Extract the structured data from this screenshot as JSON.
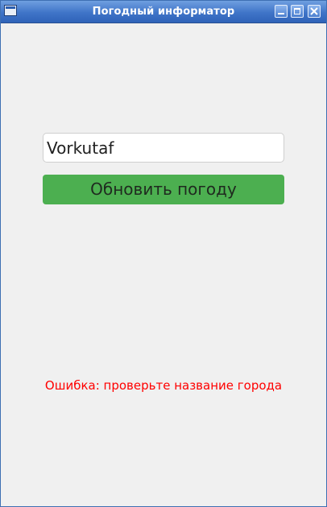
{
  "window": {
    "title": "Погодный информатор",
    "icon": "app-window-icon",
    "controls": [
      "minimize-icon",
      "maximize-icon",
      "close-icon"
    ],
    "titlebar_color": "#3f74c8"
  },
  "form": {
    "city_value": "Vorkutaf",
    "refresh_label": "Обновить погоду",
    "button_color": "#4caf50"
  },
  "status": {
    "error_text": "Ошибка: проверьте название города",
    "error_color": "#ff0000"
  }
}
